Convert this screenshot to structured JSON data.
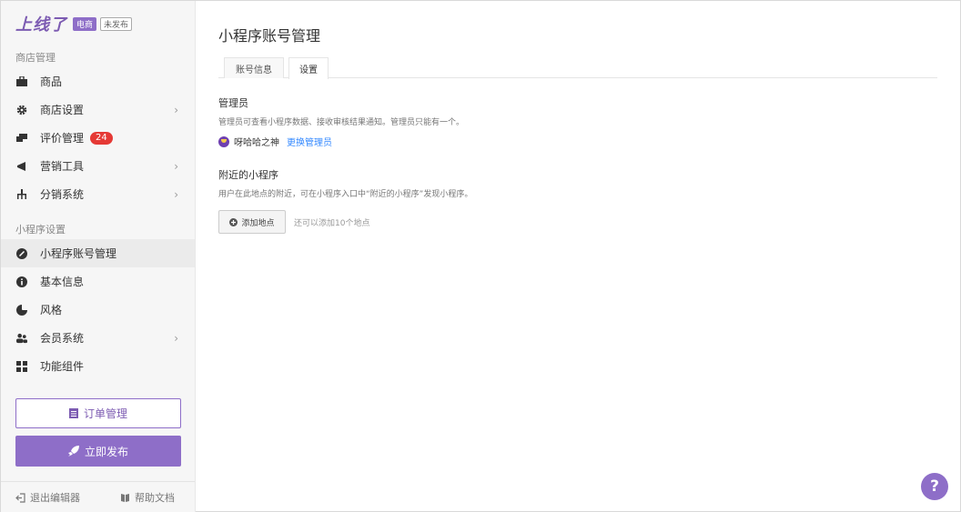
{
  "brand": {
    "logo": "上线了",
    "tag_ec": "电商",
    "tag_status": "未发布"
  },
  "sidebar": {
    "store_section": "商店管理",
    "store_items": [
      {
        "label": "商品",
        "icon": "bag-icon"
      },
      {
        "label": "商店设置",
        "icon": "gear-icon",
        "chevron": "›"
      },
      {
        "label": "评价管理",
        "icon": "comment-icon",
        "badge": "24"
      },
      {
        "label": "营销工具",
        "icon": "megaphone-icon",
        "chevron": "›"
      },
      {
        "label": "分销系统",
        "icon": "network-icon",
        "chevron": "›"
      }
    ],
    "mini_section": "小程序设置",
    "mini_items": [
      {
        "label": "小程序账号管理",
        "icon": "link-icon",
        "active": true
      },
      {
        "label": "基本信息",
        "icon": "info-icon"
      },
      {
        "label": "风格",
        "icon": "palette-icon"
      },
      {
        "label": "会员系统",
        "icon": "users-icon",
        "chevron": "›"
      },
      {
        "label": "功能组件",
        "icon": "grid-icon"
      }
    ],
    "order_button": "订单管理",
    "publish_button": "立即发布",
    "footer": {
      "exit": "退出编辑器",
      "help": "帮助文档"
    }
  },
  "main": {
    "title": "小程序账号管理",
    "tabs": [
      {
        "label": "账号信息",
        "active": false
      },
      {
        "label": "设置",
        "active": true
      }
    ],
    "admin": {
      "heading": "管理员",
      "description": "管理员可查看小程序数据、接收审核结果通知。管理员只能有一个。",
      "name": "呀哈哈之神",
      "change_link": "更换管理员"
    },
    "nearby": {
      "heading": "附近的小程序",
      "description": "用户在此地点的附近，可在小程序入口中“附近的小程序”发现小程序。",
      "add_button": "添加地点",
      "hint": "还可以添加10个地点"
    },
    "help_button": "?"
  },
  "colors": {
    "accent": "#8e6ec8",
    "badge": "#e53935",
    "link": "#3388ff"
  }
}
